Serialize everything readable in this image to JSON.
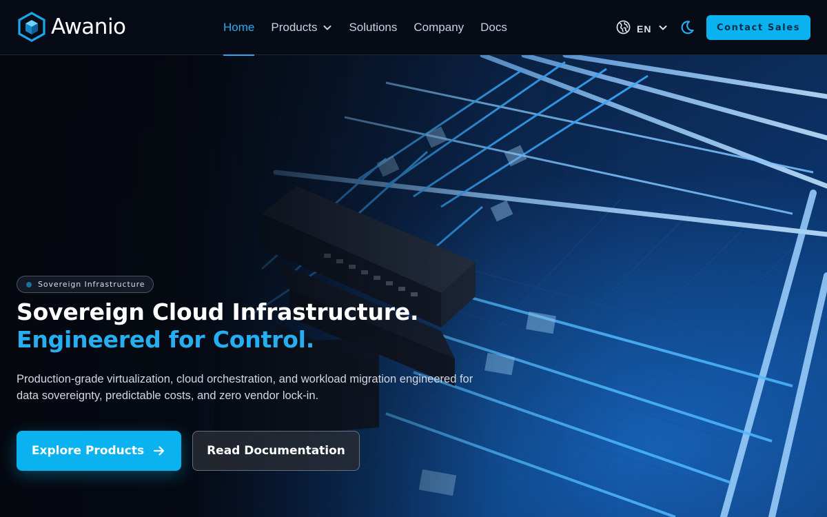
{
  "brand": {
    "name": "Awanio",
    "logo_icon": "hexagon-cube-logo",
    "accent_color": "#0bb2f0"
  },
  "nav": {
    "links": [
      {
        "label": "Home",
        "active": true
      },
      {
        "label": "Products",
        "has_dropdown": true
      },
      {
        "label": "Solutions"
      },
      {
        "label": "Company"
      },
      {
        "label": "Docs"
      }
    ],
    "language": {
      "icon": "globe-icon",
      "value": "EN"
    },
    "theme_toggle_icon": "moon-icon",
    "contact_label": "Contact Sales"
  },
  "hero": {
    "badge": "Sovereign Infrastructure",
    "title_line1": "Sovereign Cloud Infrastructure.",
    "title_line2": "Engineered for Control.",
    "description": "Production-grade virtualization, cloud orchestration, and workload migration engineered for data sovereignty, predictable costs, and zero vendor lock-in.",
    "primary_cta": "Explore Products",
    "secondary_cta": "Read Documentation"
  }
}
